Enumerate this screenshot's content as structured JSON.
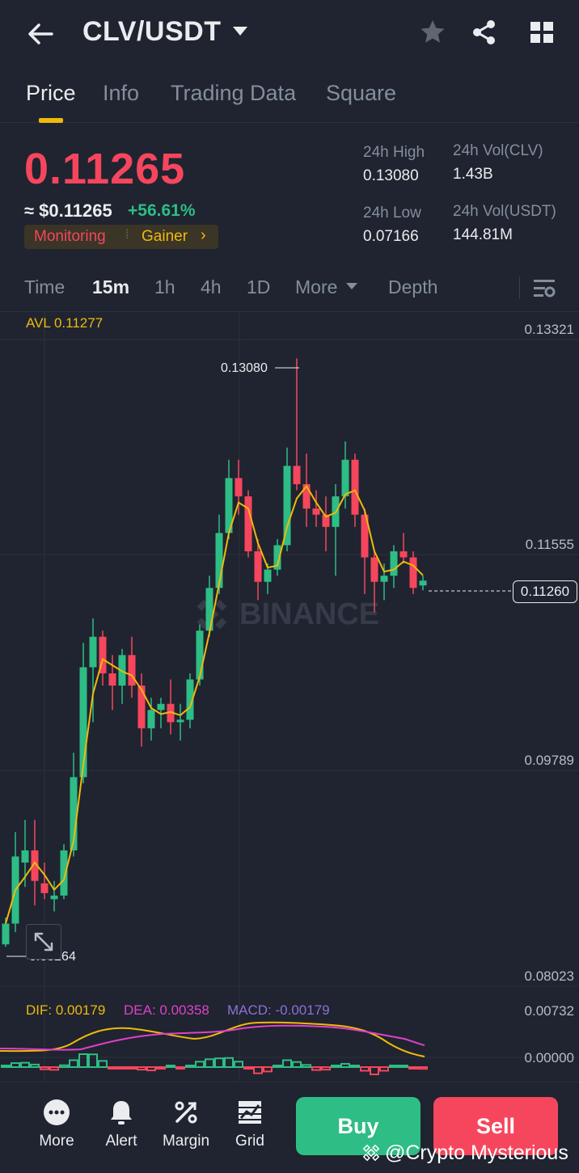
{
  "header": {
    "pair": "CLV/USDT",
    "icons": [
      "back-arrow-icon",
      "star-icon",
      "share-icon",
      "grid-apps-icon"
    ]
  },
  "tabs": [
    {
      "label": "Price",
      "active": true
    },
    {
      "label": "Info",
      "active": false
    },
    {
      "label": "Trading Data",
      "active": false
    },
    {
      "label": "Square",
      "active": false
    }
  ],
  "ticker": {
    "last_price": "0.11265",
    "usd_price": "≈ $0.11265",
    "change": "+56.61%",
    "tag_monitoring": "Monitoring",
    "tag_gainer": "Gainer",
    "high_label": "24h High",
    "high_value": "0.13080",
    "low_label": "24h Low",
    "low_value": "0.07166",
    "vol_base_label": "24h Vol(CLV)",
    "vol_base_value": "1.43B",
    "vol_quote_label": "24h Vol(USDT)",
    "vol_quote_value": "144.81M"
  },
  "intervals": {
    "items": [
      "Time",
      "15m",
      "1h",
      "4h",
      "1D",
      "More",
      "Depth"
    ],
    "active": "15m"
  },
  "chart": {
    "avl": "AVL 0.11277",
    "y_axis": [
      "0.13321",
      "0.11555",
      "0.09789",
      "0.08023"
    ],
    "high_marker": "0.13080",
    "low_marker": "0.08264",
    "current_price": "0.11260",
    "watermark": "BINANCE",
    "macd_axis": [
      "0.00732",
      "0.00000"
    ],
    "dif": "DIF: 0.00179",
    "dea": "DEA: 0.00358",
    "macd": "MACD: -0.00179"
  },
  "chart_data": {
    "type": "candlestick",
    "ylim": [
      0.08023,
      0.13321
    ],
    "up_color": "#2ebd85",
    "down_color": "#f6465d",
    "ma_color": "#f0b90b",
    "candles": [
      {
        "o": 0.0828,
        "h": 0.085,
        "l": 0.0826,
        "c": 0.0845
      },
      {
        "o": 0.0845,
        "h": 0.092,
        "l": 0.0838,
        "c": 0.09
      },
      {
        "o": 0.0895,
        "h": 0.093,
        "l": 0.0875,
        "c": 0.0905
      },
      {
        "o": 0.0905,
        "h": 0.093,
        "l": 0.086,
        "c": 0.088
      },
      {
        "o": 0.0878,
        "h": 0.0895,
        "l": 0.0865,
        "c": 0.087
      },
      {
        "o": 0.0865,
        "h": 0.088,
        "l": 0.0855,
        "c": 0.0868
      },
      {
        "o": 0.0868,
        "h": 0.091,
        "l": 0.0865,
        "c": 0.0905
      },
      {
        "o": 0.0905,
        "h": 0.0985,
        "l": 0.09,
        "c": 0.0965
      },
      {
        "o": 0.0965,
        "h": 0.1075,
        "l": 0.096,
        "c": 0.1055
      },
      {
        "o": 0.1055,
        "h": 0.1095,
        "l": 0.101,
        "c": 0.108
      },
      {
        "o": 0.108,
        "h": 0.1085,
        "l": 0.104,
        "c": 0.105
      },
      {
        "o": 0.105,
        "h": 0.1065,
        "l": 0.102,
        "c": 0.104
      },
      {
        "o": 0.104,
        "h": 0.107,
        "l": 0.1025,
        "c": 0.1065
      },
      {
        "o": 0.1065,
        "h": 0.108,
        "l": 0.103,
        "c": 0.104
      },
      {
        "o": 0.104,
        "h": 0.105,
        "l": 0.099,
        "c": 0.1005
      },
      {
        "o": 0.1005,
        "h": 0.103,
        "l": 0.0995,
        "c": 0.102
      },
      {
        "o": 0.102,
        "h": 0.103,
        "l": 0.1005,
        "c": 0.1025
      },
      {
        "o": 0.1025,
        "h": 0.1045,
        "l": 0.1,
        "c": 0.101
      },
      {
        "o": 0.101,
        "h": 0.1025,
        "l": 0.0995,
        "c": 0.1012
      },
      {
        "o": 0.1012,
        "h": 0.105,
        "l": 0.1005,
        "c": 0.1045
      },
      {
        "o": 0.1045,
        "h": 0.109,
        "l": 0.104,
        "c": 0.1085
      },
      {
        "o": 0.1085,
        "h": 0.113,
        "l": 0.108,
        "c": 0.112
      },
      {
        "o": 0.112,
        "h": 0.118,
        "l": 0.1115,
        "c": 0.1165
      },
      {
        "o": 0.1165,
        "h": 0.1225,
        "l": 0.116,
        "c": 0.121
      },
      {
        "o": 0.121,
        "h": 0.1225,
        "l": 0.118,
        "c": 0.1195
      },
      {
        "o": 0.1195,
        "h": 0.12,
        "l": 0.1145,
        "c": 0.115
      },
      {
        "o": 0.115,
        "h": 0.116,
        "l": 0.111,
        "c": 0.1125
      },
      {
        "o": 0.1125,
        "h": 0.114,
        "l": 0.1115,
        "c": 0.1135
      },
      {
        "o": 0.1135,
        "h": 0.116,
        "l": 0.113,
        "c": 0.1155
      },
      {
        "o": 0.1155,
        "h": 0.1235,
        "l": 0.115,
        "c": 0.122
      },
      {
        "o": 0.122,
        "h": 0.1308,
        "l": 0.12,
        "c": 0.1205
      },
      {
        "o": 0.1205,
        "h": 0.123,
        "l": 0.117,
        "c": 0.1185
      },
      {
        "o": 0.1185,
        "h": 0.12,
        "l": 0.117,
        "c": 0.118
      },
      {
        "o": 0.118,
        "h": 0.1195,
        "l": 0.115,
        "c": 0.117
      },
      {
        "o": 0.117,
        "h": 0.1205,
        "l": 0.113,
        "c": 0.1195
      },
      {
        "o": 0.1195,
        "h": 0.124,
        "l": 0.1185,
        "c": 0.1225
      },
      {
        "o": 0.1225,
        "h": 0.123,
        "l": 0.117,
        "c": 0.118
      },
      {
        "o": 0.118,
        "h": 0.1185,
        "l": 0.1115,
        "c": 0.1145
      },
      {
        "o": 0.1145,
        "h": 0.115,
        "l": 0.11,
        "c": 0.1125
      },
      {
        "o": 0.1125,
        "h": 0.114,
        "l": 0.111,
        "c": 0.113
      },
      {
        "o": 0.113,
        "h": 0.1155,
        "l": 0.112,
        "c": 0.115
      },
      {
        "o": 0.115,
        "h": 0.1165,
        "l": 0.114,
        "c": 0.1145
      },
      {
        "o": 0.1145,
        "h": 0.115,
        "l": 0.1115,
        "c": 0.112
      },
      {
        "o": 0.1122,
        "h": 0.113,
        "l": 0.1118,
        "c": 0.1126
      }
    ]
  }
}
